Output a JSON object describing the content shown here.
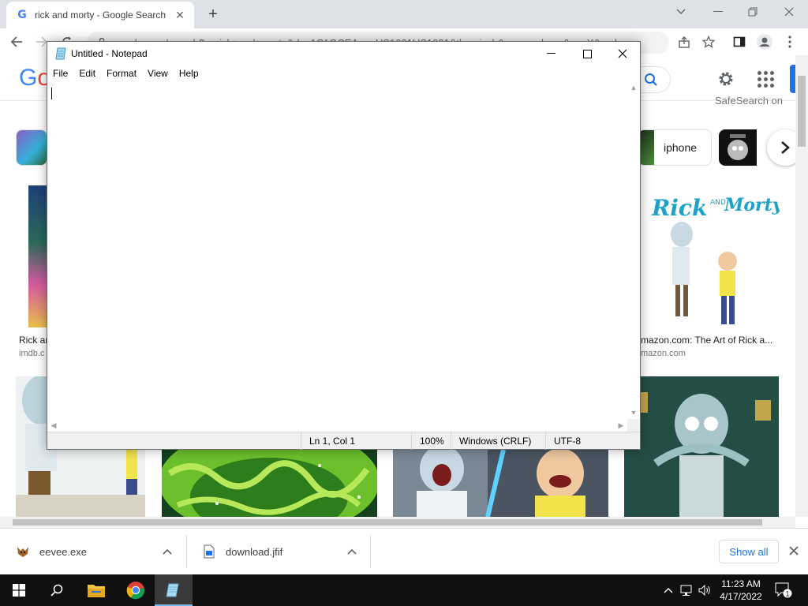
{
  "browser": {
    "tab_title": "rick and morty - Google Search",
    "url": "google.com/search?q=rick+and+morty&rlz=1C1GCEA_enUS1001US1001&tbm=isch&source=lnms&sa=X&ved..."
  },
  "google": {
    "chips": [
      {
        "label": "iphone"
      }
    ],
    "results": [
      {
        "title": "Rick ar",
        "source": "imdb.c"
      },
      {
        "title": "mazon.com: The Art of Rick a...",
        "source": "mazon.com"
      }
    ],
    "safesearch_text": "SafeSearch on"
  },
  "downloads": {
    "items": [
      {
        "name": "eevee.exe"
      },
      {
        "name": "download.jfif"
      }
    ],
    "show_all": "Show all"
  },
  "notepad": {
    "title": "Untitled - Notepad",
    "menu": [
      "File",
      "Edit",
      "Format",
      "View",
      "Help"
    ],
    "content": "",
    "status": {
      "position": "Ln 1, Col 1",
      "zoom": "100%",
      "line_endings": "Windows (CRLF)",
      "encoding": "UTF-8"
    }
  },
  "taskbar": {
    "time": "11:23 AM",
    "date": "4/17/2022",
    "notification_count": "1"
  },
  "colors": {
    "chrome_frame": "#dee1e6",
    "accent_blue": "#1a73e8",
    "taskbar": "#101010",
    "rm_green": "#2e8b57"
  }
}
